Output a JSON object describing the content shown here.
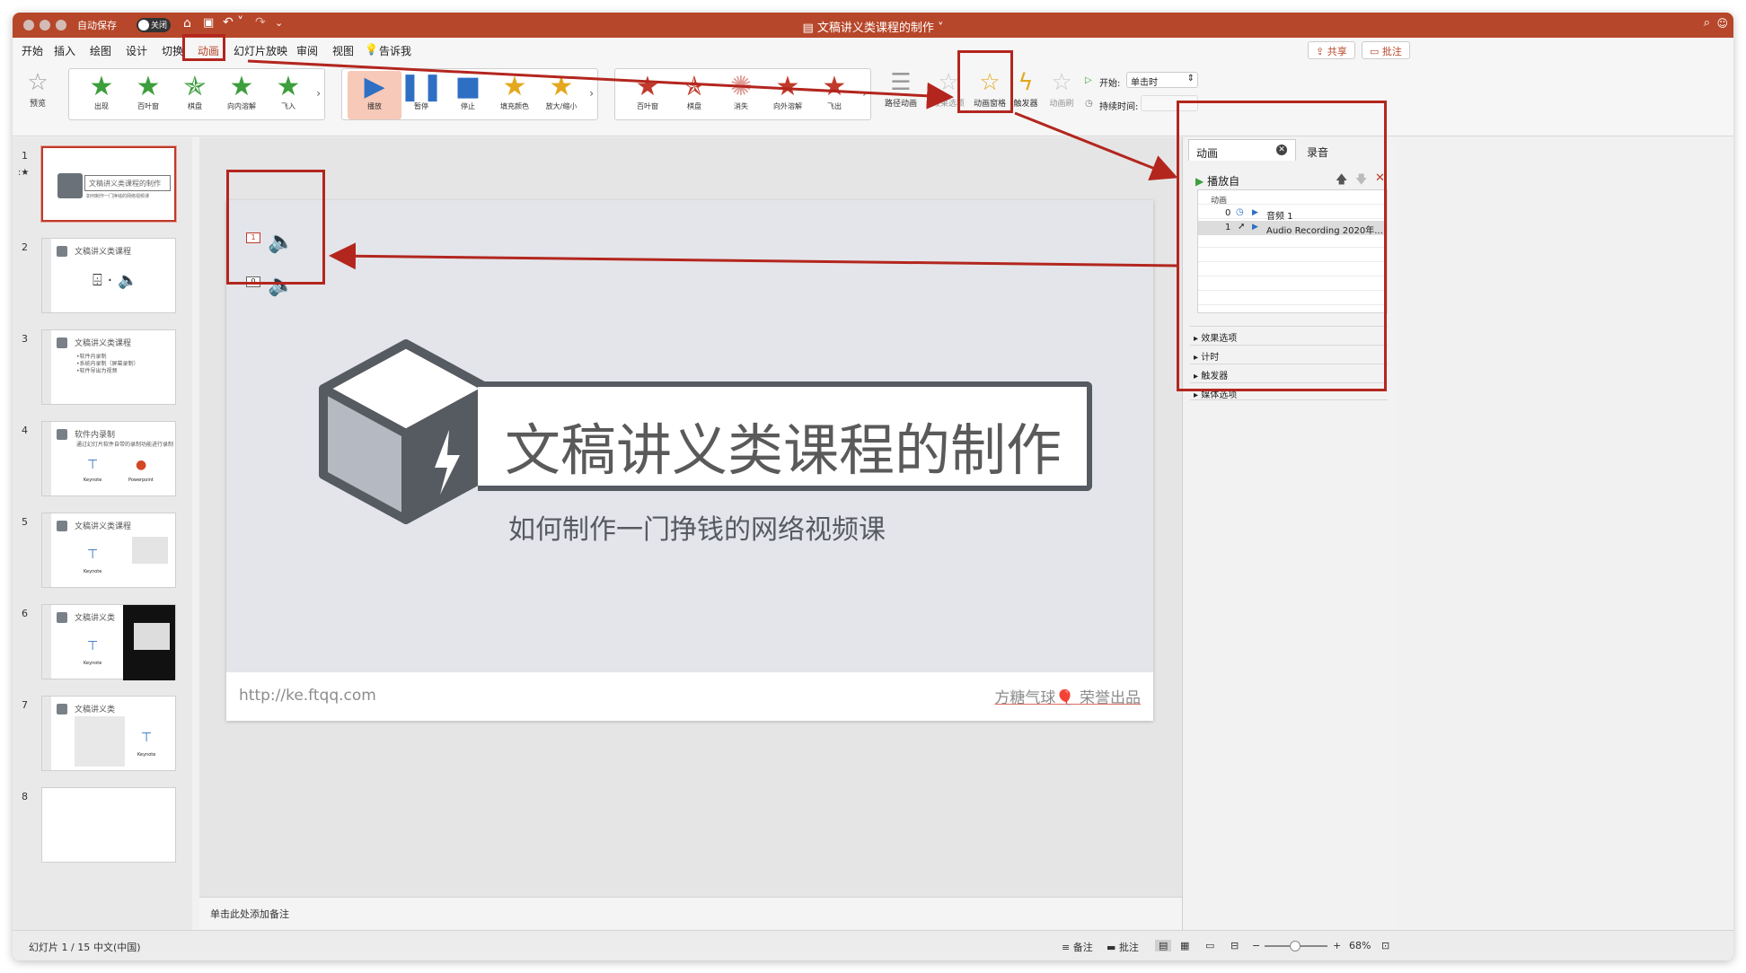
{
  "titlebar": {
    "autosave": "自动保存",
    "toggle": "关闭",
    "doc_title": "文稿讲义类课程的制作"
  },
  "menubar": {
    "items": [
      "开始",
      "插入",
      "绘图",
      "设计",
      "切换",
      "动画",
      "幻灯片放映",
      "审阅",
      "视图"
    ],
    "tellme": "告诉我",
    "share": "共享",
    "comment": "批注"
  },
  "ribbon": {
    "preview": "预览",
    "entrance": [
      "出现",
      "百叶窗",
      "棋盘",
      "向内溶解",
      "飞入"
    ],
    "media": [
      "播放",
      "暂停",
      "停止",
      "填充颜色",
      "放大/缩小"
    ],
    "exit": [
      "百叶窗",
      "棋盘",
      "消失",
      "向外溶解",
      "飞出"
    ],
    "path": "路径动画",
    "effect_options": "效果选项",
    "anim_pane": "动画窗格",
    "trigger": "触发器",
    "anim_painter": "动画刷",
    "start_label": "开始:",
    "start_value": "单击时",
    "duration_label": "持续时间:"
  },
  "thumbnails": [
    {
      "num": "1",
      "title": "文稿讲义类课程的制作",
      "sub": "如何制作一门挣钱的网络视频课"
    },
    {
      "num": "2",
      "title": "文稿讲义类课程"
    },
    {
      "num": "3",
      "title": "文稿讲义类课程",
      "body": "•软件内录制\n•系统内录制（屏幕录制）\n•软件导出为视频"
    },
    {
      "num": "4",
      "title": "软件内录制",
      "body": "通过幻灯片软件自带的录制功能进行录制",
      "a": "Keynote",
      "b": "Powerpoint"
    },
    {
      "num": "5",
      "title": "文稿讲义类课程",
      "a": "Keynote"
    },
    {
      "num": "6",
      "title": "文稿讲义类",
      "a": "Keynote"
    },
    {
      "num": "7",
      "title": "文稿讲义类",
      "a": "Keynote"
    },
    {
      "num": "8",
      "title": ""
    }
  ],
  "slide": {
    "title": "文稿讲义类课程的制作",
    "subtitle": "如何制作一门挣钱的网络视频课",
    "url": "http://ke.ftqq.com",
    "brand": "方糖气球🎈 荣誉出品",
    "tag1": "1",
    "tag0": "0"
  },
  "notes": {
    "placeholder": "单击此处添加备注"
  },
  "panel": {
    "tab_anim": "动画",
    "tab_record": "录音",
    "play_from": "播放自",
    "list_header": "动画",
    "rows": [
      {
        "num": "0",
        "label": "音频 1"
      },
      {
        "num": "1",
        "label": "Audio Recording 2020年..."
      }
    ],
    "sections": [
      "效果选项",
      "计时",
      "触发器",
      "媒体选项"
    ]
  },
  "status": {
    "slide": "幻灯片 1 / 15",
    "lang": "中文(中国)",
    "notes": "备注",
    "comments": "批注",
    "zoom": "68%"
  },
  "colors": {
    "accent": "#b7472a",
    "highlight": "#b3261e"
  }
}
